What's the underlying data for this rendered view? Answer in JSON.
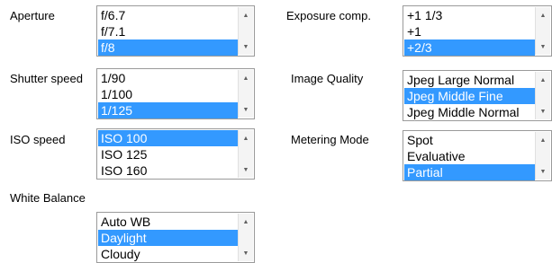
{
  "settings": {
    "aperture": {
      "label": "Aperture",
      "options": [
        "f/6.7",
        "f/7.1",
        "f/8"
      ],
      "selected": 2
    },
    "shutter_speed": {
      "label": "Shutter speed",
      "options": [
        "1/90",
        "1/100",
        "1/125"
      ],
      "selected": 2
    },
    "iso_speed": {
      "label": "ISO speed",
      "options": [
        "ISO 100",
        "ISO 125",
        "ISO 160"
      ],
      "selected": 0
    },
    "white_balance": {
      "label": "White Balance",
      "options": [
        "Auto WB",
        "Daylight",
        "Cloudy"
      ],
      "selected": 1
    },
    "exposure_comp": {
      "label": "Exposure comp.",
      "options": [
        "+1 1/3",
        "+1",
        "+2/3"
      ],
      "selected": 2
    },
    "image_quality": {
      "label": "Image Quality",
      "options": [
        "Jpeg Large Normal",
        "Jpeg Middle Fine",
        "Jpeg Middle Normal"
      ],
      "selected": 1
    },
    "metering_mode": {
      "label": "Metering Mode",
      "options": [
        "Spot",
        "Evaluative",
        "Partial"
      ],
      "selected": 2
    }
  },
  "icons": {
    "scroll_up": "scroll-up-arrow-icon",
    "scroll_down": "scroll-down-arrow-icon"
  },
  "colors": {
    "selection_background": "#3399ff",
    "selection_text": "#ffffff",
    "listbox_border": "#9a9a9a"
  }
}
